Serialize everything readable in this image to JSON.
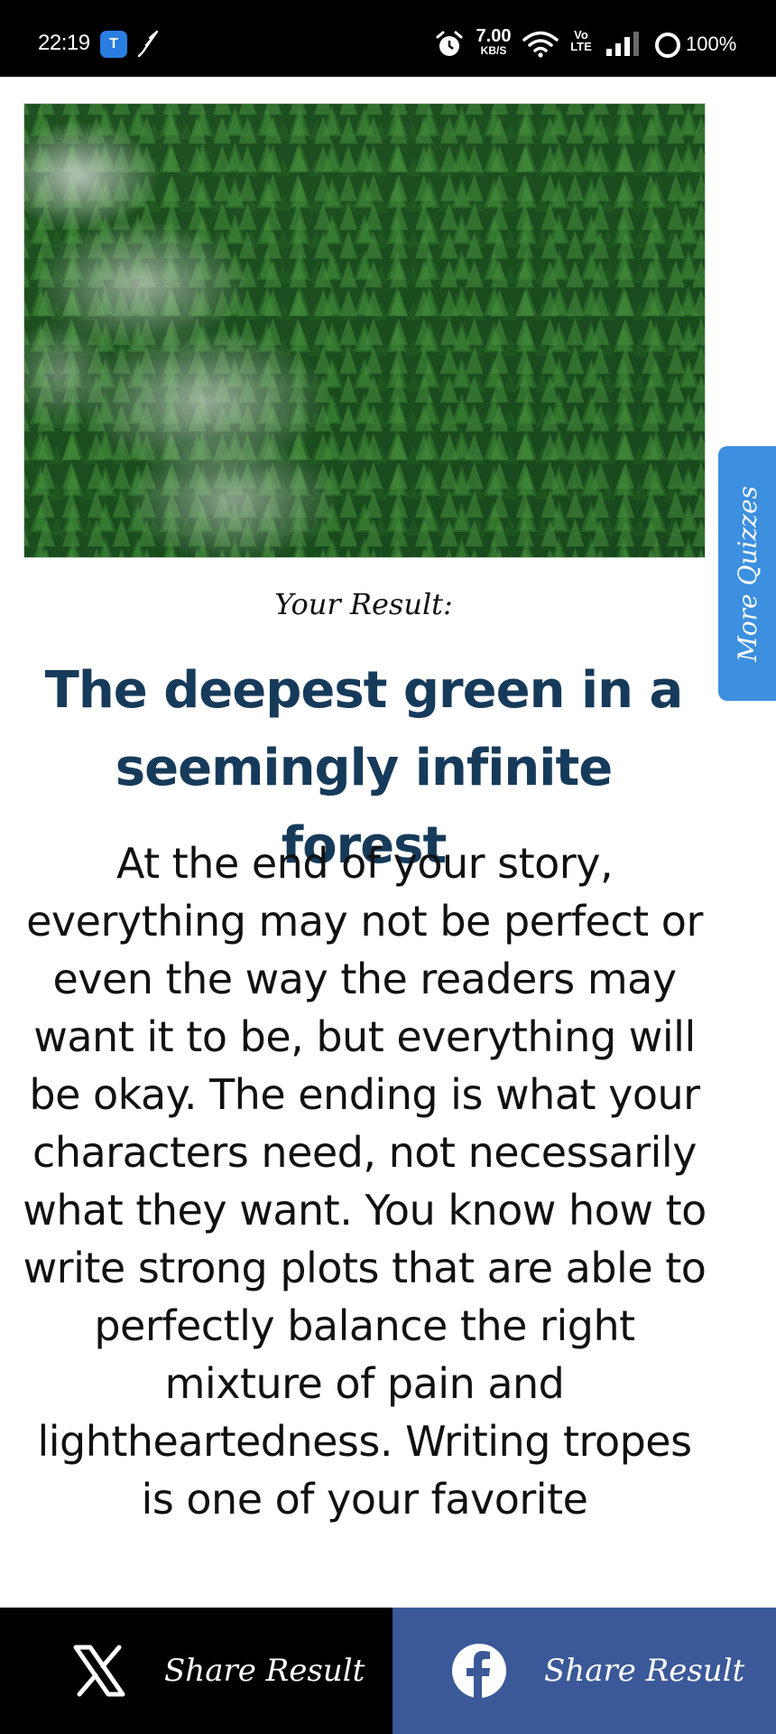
{
  "status_bar": {
    "time": "22:19",
    "app_icon_letter": "T",
    "net_speed_value": "7.00",
    "net_speed_unit": "KB/S",
    "volte_top": "Vo",
    "volte_bottom": "LTE",
    "battery": "100%"
  },
  "side_tab": {
    "label": "More Quizzes"
  },
  "result": {
    "label": "Your Result:",
    "title": "The deepest green in a seemingly infinite forest",
    "body": "At the end of your story, everything may not be perfect or even the way the readers may want it to be, but everything will be okay. The ending is what your characters need, not necessarily what they want. You know how to write strong plots that are able to perfectly balance the right mixture of pain and lightheartedness. Writing tropes is one of your favorite"
  },
  "share": {
    "x_label": "Share Result",
    "facebook_label": "Share Result"
  },
  "colors": {
    "title": "#163a5a",
    "side_tab": "#3d8fe0",
    "facebook": "#3b5998",
    "x_bar": "#000000"
  },
  "icons": [
    "alarm-icon",
    "wifi-icon",
    "signal-icon",
    "battery-icon",
    "x-logo-icon",
    "facebook-logo-icon"
  ]
}
